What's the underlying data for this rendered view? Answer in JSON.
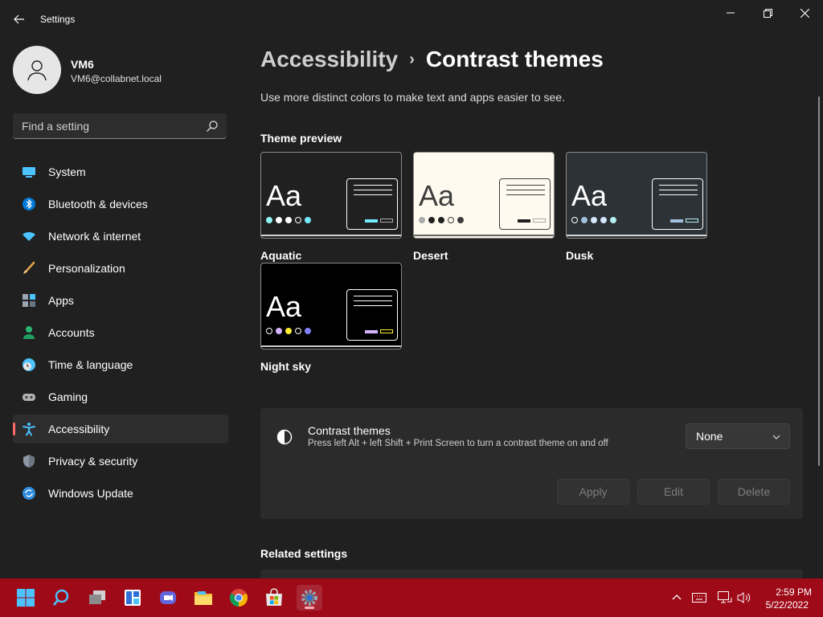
{
  "window": {
    "title": "Settings",
    "icons": {
      "back": "back-arrow-icon",
      "minimize": "minimize-icon",
      "maximize": "restore-icon",
      "close": "close-icon"
    }
  },
  "profile": {
    "name": "VM6",
    "email": "VM6@collabnet.local",
    "avatar_icon": "person-icon"
  },
  "search": {
    "placeholder": "Find a setting",
    "icon": "search-icon"
  },
  "nav": {
    "items": [
      {
        "label": "System",
        "icon": "monitor-icon"
      },
      {
        "label": "Bluetooth & devices",
        "icon": "bluetooth-icon"
      },
      {
        "label": "Network & internet",
        "icon": "wifi-icon"
      },
      {
        "label": "Personalization",
        "icon": "paintbrush-icon"
      },
      {
        "label": "Apps",
        "icon": "apps-icon"
      },
      {
        "label": "Accounts",
        "icon": "person-icon"
      },
      {
        "label": "Time & language",
        "icon": "clock-globe-icon"
      },
      {
        "label": "Gaming",
        "icon": "gamepad-icon"
      },
      {
        "label": "Accessibility",
        "icon": "accessibility-icon"
      },
      {
        "label": "Privacy & security",
        "icon": "shield-icon"
      },
      {
        "label": "Windows Update",
        "icon": "update-icon"
      }
    ],
    "selected": "Accessibility",
    "accent": "#ff6b6b"
  },
  "main": {
    "breadcrumb": {
      "parent": "Accessibility",
      "separator": "›",
      "current": "Contrast themes"
    },
    "subtitle": "Use more distinct colors to make text and apps easier to see.",
    "preview_title": "Theme preview",
    "themes": [
      {
        "label": "Aquatic",
        "aa": "Aa",
        "bg": "#202020",
        "fg": "#ffffff",
        "dots": [
          "#8ff5f5",
          "#ffffff",
          "#ffffff",
          "#202020",
          "#75e9fc"
        ],
        "btn1": "#75e9fc",
        "btn2": "#aaaaaa"
      },
      {
        "label": "Desert",
        "aa": "Aa",
        "bg": "#fffaef",
        "fg": "#3d3d3d",
        "dots": [
          "#aaaaaa",
          "#202020",
          "#202020",
          "#fffaef",
          "#3d3d3d"
        ],
        "btn1": "#202020",
        "btn2": "#aaaaaa"
      },
      {
        "label": "Dusk",
        "aa": "Aa",
        "bg": "#2d3236",
        "fg": "#ffffff",
        "dots": [
          "#2d3236",
          "#a1bfde",
          "#d6e7ff",
          "#d6e7ff",
          "#b5f0f0"
        ],
        "btn1": "#a1bfde",
        "btn2": "#b5f0f0"
      },
      {
        "label": "Night sky",
        "aa": "Aa",
        "bg": "#000000",
        "fg": "#ffffff",
        "dots": [
          "#000000",
          "#d6b4fd",
          "#ffee32",
          "#000000",
          "#8080ff"
        ],
        "btn1": "#d6b4fd",
        "btn2": "#ffee32"
      }
    ]
  },
  "contrast_panel": {
    "title": "Contrast themes",
    "description": "Press left Alt + left Shift + Print Screen to turn a contrast theme on and off",
    "icon": "contrast-icon",
    "dropdown_value": "None",
    "buttons": {
      "apply": "Apply",
      "edit": "Edit",
      "delete": "Delete"
    }
  },
  "related": {
    "title": "Related settings"
  },
  "taskbar": {
    "apps": [
      "windows-start-icon",
      "search-icon",
      "task-view-icon",
      "widgets-icon",
      "teams-chat-icon",
      "file-explorer-icon",
      "chrome-icon",
      "store-icon",
      "settings-icon"
    ],
    "tray": [
      "chevron-up-icon",
      "keyboard-icon",
      "network-icon",
      "volume-icon"
    ],
    "time": "2:59 PM",
    "date": "5/22/2022"
  }
}
